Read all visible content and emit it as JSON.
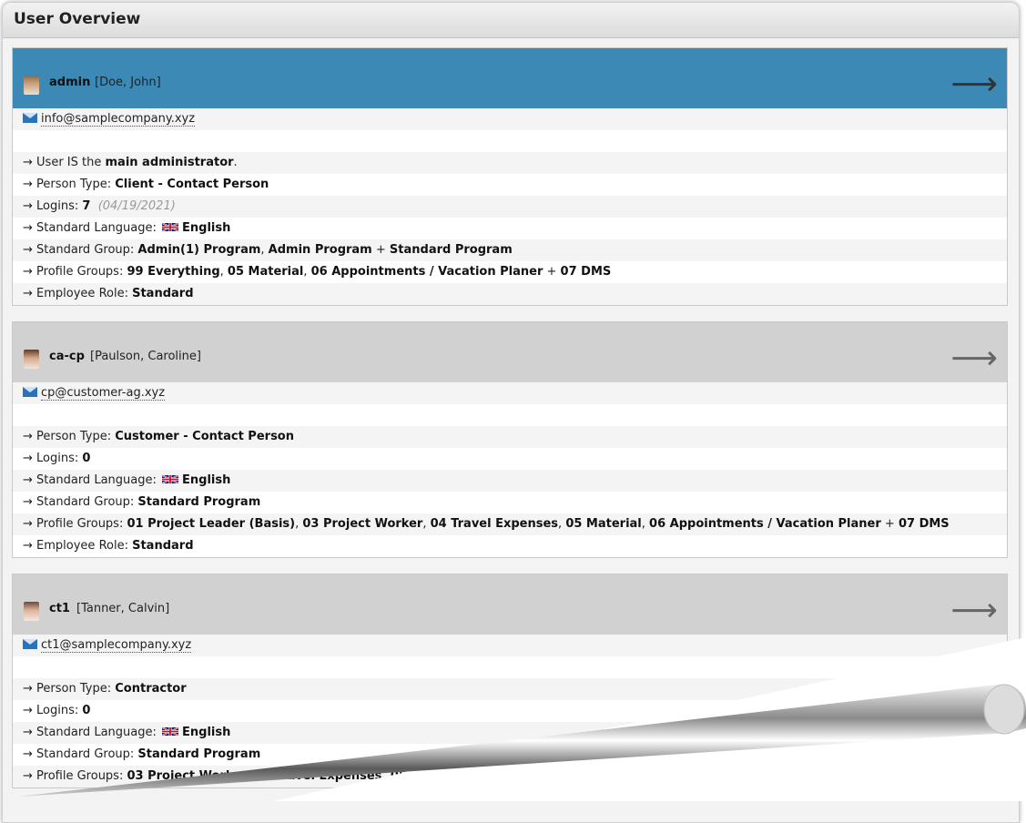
{
  "page": {
    "title": "User Overview"
  },
  "users": [
    {
      "username": "admin",
      "fullname": "[Doe, John]",
      "email": "info@samplecompany.xyz",
      "main_admin": {
        "prefix": "User IS the ",
        "value": "main administrator",
        "suffix": "."
      },
      "person_type": {
        "label": "Person Type: ",
        "value": "Client - Contact Person"
      },
      "logins": {
        "label": "Logins: ",
        "value": "7",
        "date": "(04/19/2021)"
      },
      "language": {
        "label": "Standard Language: ",
        "value": "English"
      },
      "std_group": {
        "label": "Standard Group: ",
        "values": [
          "Admin(1) Program",
          "Admin Program"
        ],
        "plus": "Standard Program"
      },
      "profile_groups": {
        "label": "Profile Groups: ",
        "values": [
          "99 Everything",
          "05 Material",
          "06 Appointments / Vacation Planer"
        ],
        "plus": "07 DMS"
      },
      "role": {
        "label": "Employee Role: ",
        "value": "Standard"
      }
    },
    {
      "username": "ca-cp",
      "fullname": "[Paulson, Caroline]",
      "email": "cp@customer-ag.xyz",
      "person_type": {
        "label": "Person Type: ",
        "value": "Customer - Contact Person"
      },
      "logins": {
        "label": "Logins: ",
        "value": "0"
      },
      "language": {
        "label": "Standard Language: ",
        "value": "English"
      },
      "std_group": {
        "label": "Standard Group: ",
        "value": "Standard Program"
      },
      "profile_groups": {
        "label": "Profile Groups: ",
        "values": [
          "01 Project Leader (Basis)",
          "03 Project Worker",
          "04 Travel Expenses",
          "05 Material",
          "06 Appointments / Vacation Planer"
        ],
        "plus": "07 DMS"
      },
      "role": {
        "label": "Employee Role: ",
        "value": "Standard"
      }
    },
    {
      "username": "ct1",
      "fullname": "[Tanner, Calvin]",
      "email": "ct1@samplecompany.xyz",
      "person_type": {
        "label": "Person Type: ",
        "value": "Contractor"
      },
      "logins": {
        "label": "Logins: ",
        "value": "0"
      },
      "language": {
        "label": "Standard Language: ",
        "value": "English"
      },
      "std_group": {
        "label": "Standard Group: ",
        "value": "Standard Program"
      },
      "profile_groups": {
        "label": "Profile Groups: ",
        "value": "03 Project Worker, 04 Travel Expenses, 05 M..."
      }
    }
  ],
  "symbols": {
    "arrow_small": "→",
    "arrow_big": "⟶",
    "plus": " + ",
    "comma": ", "
  },
  "colors": {
    "active_header": "#3d89b5",
    "inactive_header": "#d1d1d1",
    "mail_icon": "#2a73b8"
  }
}
